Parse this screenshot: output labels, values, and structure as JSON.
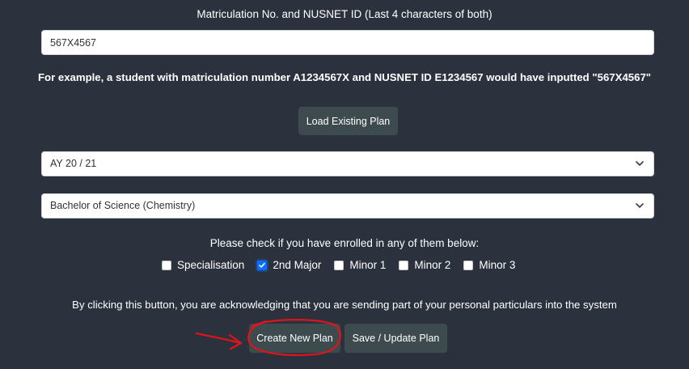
{
  "matric": {
    "label": "Matriculation No. and NUSNET ID (Last 4 characters of both)",
    "value": "567X4567",
    "example": "For example, a student with matriculation number A1234567X and NUSNET ID E1234567 would have inputted \"567X4567\""
  },
  "load_button": "Load Existing Plan",
  "academic_year": {
    "selected": "AY 20 / 21"
  },
  "degree": {
    "selected": "Bachelor of Science (Chemistry)"
  },
  "enrollment": {
    "label": "Please check if you have enrolled in any of them below:",
    "options": [
      {
        "label": "Specialisation",
        "checked": false
      },
      {
        "label": "2nd Major",
        "checked": true
      },
      {
        "label": "Minor 1",
        "checked": false
      },
      {
        "label": "Minor 2",
        "checked": false
      },
      {
        "label": "Minor 3",
        "checked": false
      }
    ]
  },
  "acknowledgement": "By clicking this button, you are acknowledging that you are sending part of your personal particulars into the system",
  "create_button": "Create New Plan",
  "save_button": "Save / Update Plan",
  "colors": {
    "background": "#2b323d",
    "button": "#3d4a4e",
    "checkbox_checked": "#0d6efd",
    "annotation": "#e0141a"
  }
}
